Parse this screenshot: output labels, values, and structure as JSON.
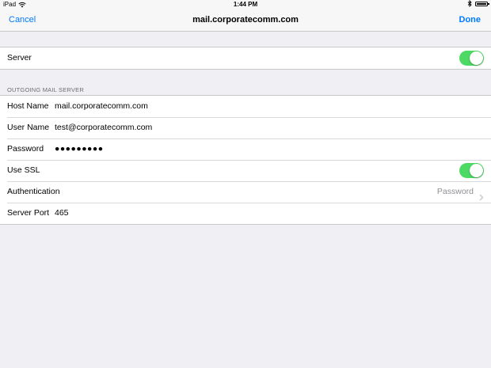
{
  "status_bar": {
    "device": "iPad",
    "time": "1:44 PM"
  },
  "nav": {
    "cancel_label": "Cancel",
    "title": "mail.corporatecomm.com",
    "done_label": "Done"
  },
  "server_group": {
    "server_label": "Server",
    "server_enabled": true
  },
  "outgoing": {
    "section_header": "OUTGOING MAIL SERVER",
    "host_name_label": "Host Name",
    "host_name_value": "mail.corporatecomm.com",
    "user_name_label": "User Name",
    "user_name_value": "test@corporatecomm.com",
    "password_label": "Password",
    "password_value": "●●●●●●●●●",
    "use_ssl_label": "Use SSL",
    "use_ssl_enabled": true,
    "authentication_label": "Authentication",
    "authentication_value": "Password",
    "server_port_label": "Server Port",
    "server_port_value": "465"
  },
  "colors": {
    "accent": "#007aff",
    "toggle_on": "#4cd964",
    "background": "#efeff4"
  }
}
